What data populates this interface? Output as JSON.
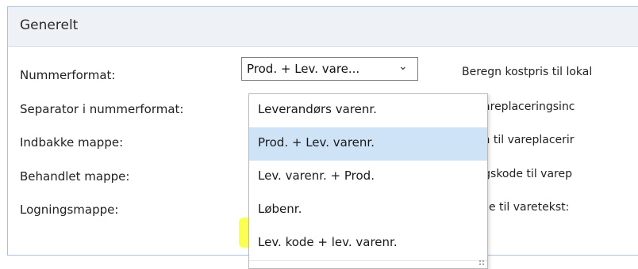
{
  "section": {
    "title": "Generelt"
  },
  "labels": {
    "number_format": "Nummerformat:",
    "separator": "Separator i nummerformat:",
    "inbox_folder": "Indbakke mappe:",
    "processed_folder": "Behandlet mappe:",
    "log_folder": "Logningsmappe:"
  },
  "right_labels": [
    "Beregn kostpris til lokal",
    "et Vareplaceringsinc",
    "ation til vareplacerir",
    "eringskode til varep",
    "gkode til varetekst:"
  ],
  "number_format_select": {
    "value": "Prod. + Lev. vare...",
    "options": [
      "Leverandørs varenr.",
      "Prod. + Lev. varenr.",
      "Lev. varenr. + Prod.",
      "Løbenr.",
      "Lev. kode + lev. varenr."
    ],
    "selected_index": 1,
    "highlighted_index": 4
  },
  "colors": {
    "panel_border": "#a9c3df",
    "header_bg": "#eef1f5",
    "selected_option_bg": "#cfe3f6",
    "highlight": "#fbff42"
  }
}
